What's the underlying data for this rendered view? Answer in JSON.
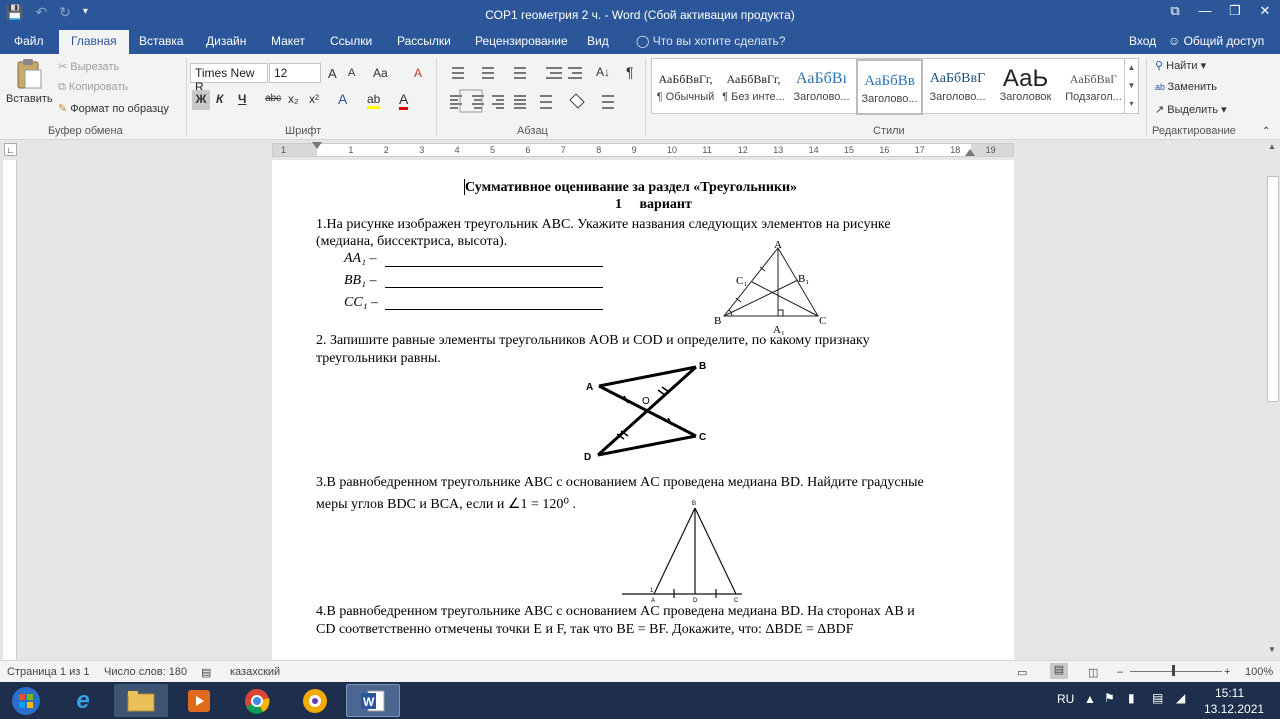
{
  "window": {
    "title": "СОР1 геометрия 2 ч. - Word (Сбой активации продукта)",
    "controls": [
      "⧉",
      "—",
      "❐",
      "✕"
    ]
  },
  "tabs": [
    "Файл",
    "Главная",
    "Вставка",
    "Дизайн",
    "Макет",
    "Ссылки",
    "Рассылки",
    "Рецензирование",
    "Вид"
  ],
  "tell_me": "Что вы хотите сделать?",
  "login": "Вход",
  "share": "Общий доступ",
  "ribbon": {
    "clipboard": {
      "paste": "Вставить",
      "cut": "Вырезать",
      "copy": "Копировать",
      "format_painter": "Формат по образцу",
      "label": "Буфер обмена"
    },
    "font": {
      "name": "Times New R",
      "size": "12",
      "aa": "Aa",
      "grow": "A",
      "shrink": "A",
      "clear": "A",
      "bold": "Ж",
      "italic": "К",
      "underline": "Ч",
      "strike": "abc",
      "sub": "x₂",
      "sup": "x²",
      "effects": "A",
      "highlight": "ab",
      "color": "A",
      "label": "Шрифт"
    },
    "paragraph": {
      "label": "Абзац",
      "pilcrow": "¶",
      "sort": "A↓"
    },
    "styles": {
      "label": "Стили",
      "items": [
        {
          "sample": "АаБбВвГг,",
          "label": "¶ Обычный"
        },
        {
          "sample": "АаБбВвГг,",
          "label": "¶ Без инте..."
        },
        {
          "sample": "АаБбВı",
          "label": "Заголово..."
        },
        {
          "sample": "АаБбВв",
          "label": "Заголово..."
        },
        {
          "sample": "АаБбВвГ",
          "label": "Заголово..."
        },
        {
          "sample": "АаЬ",
          "label": "Заголовок"
        },
        {
          "sample": "АаБбВвГ",
          "label": "Подзагол..."
        }
      ]
    },
    "editing": {
      "find": "Найти",
      "replace": "Заменить",
      "select": "Выделить",
      "label": "Редактирование"
    }
  },
  "ruler_numbers": [
    "1",
    "1",
    "2",
    "3",
    "4",
    "5",
    "6",
    "7",
    "8",
    "9",
    "10",
    "11",
    "12",
    "13",
    "14",
    "15",
    "16",
    "17",
    "18",
    "19"
  ],
  "document": {
    "title": "Суммативное оценивание за раздел «Треугольники»",
    "variant": "1     вариант",
    "q1": "1.На рисунке изображен треугольник ABC. Укажите названия следующих элементов на рисунке",
    "q1b": "(медиана, биссектриса, высота).",
    "q1_items": [
      "AA₁ –",
      "BB₁ –",
      "CC₁ –"
    ],
    "fig1_labels": {
      "A": "A",
      "B": "B",
      "C": "C",
      "A1": "A₁",
      "B1": "B₁",
      "C1": "C₁"
    },
    "q2": "2. Запишите равные элементы треугольников AOB и COD и определите, по какому признаку",
    "q2b": "треугольники равны.",
    "fig2_labels": {
      "A": "A",
      "B": "B",
      "C": "C",
      "D": "D",
      "O": "O"
    },
    "q3": "3.В равнобедренном треугольнике ABC с основанием AC проведена медиана BD. Найдите градусные",
    "q3b": "меры углов BDC и BCA, если и ∠1 = 120⁰ .",
    "fig3_labels": {
      "A": "A",
      "B": "B",
      "C": "C",
      "D": "D",
      "one": "1"
    },
    "q4": "4.В равнобедренном треугольнике ABC с основанием AC проведена медиана BD. На сторонах AB и",
    "q4b": "CD соответственно отмечены точки E и F, так что BE = BF. Докажите, что: ΔBDE = ΔBDF"
  },
  "status": {
    "page": "Страница 1 из 1",
    "words": "Число слов: 180",
    "lang": "казахский",
    "zoom": "100%"
  },
  "tray": {
    "lang": "RU",
    "time": "15:11",
    "date": "13.12.2021"
  }
}
